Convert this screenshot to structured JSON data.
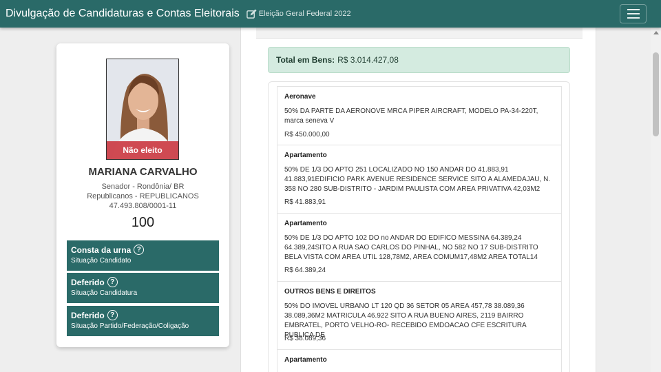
{
  "header": {
    "title": "Divulgação de Candidaturas e Contas Eleitorais",
    "election": "Eleição Geral Federal 2022",
    "icons": [
      "edit-icon",
      "menu-icon"
    ]
  },
  "candidate": {
    "photo_badge": "Não eleito",
    "name": "MARIANA CARVALHO",
    "office": "Senador - Rondônia/ BR",
    "party": "Republicanos - REPUBLICANOS",
    "cnpj": "47.493.808/0001-11",
    "number": "100",
    "statuses": [
      {
        "title": "Consta da urna",
        "subtitle": "Situação Candidato"
      },
      {
        "title": "Deferido",
        "subtitle": "Situação Candidatura"
      },
      {
        "title": "Deferido",
        "subtitle": "Situação Partido/Federação/Coligação"
      }
    ]
  },
  "assets": {
    "total_label": "Total em Bens:",
    "total_value": "R$ 3.014.427,08",
    "items": [
      {
        "type": "Aeronave",
        "description": "50% DA PARTE DA AERONOVE MRCA PIPER AIRCRAFT, MODELO PA-34-220T, marca seneva V",
        "value": "R$ 450.000,00"
      },
      {
        "type": "Apartamento",
        "description": "50% DE 1/3 DO APTO 251 LOCALIZADO NO 150 ANDAR DO 41.883,91 41.883,91EDIFICIO PARK AVENUE RESIDENCE SERVICE SITO A ALAMEDAJAU, N. 358 NO 280 SUB-DISTRITO - JARDIM PAULISTA COM AREA PRIVATIVA 42,03M2",
        "value": "R$ 41.883,91"
      },
      {
        "type": "Apartamento",
        "description": "50% DE 1/3 DO APTO 102 DO no ANDAR DO EDIFICO MESSINA 64.389,24 64.389,24SITO A RUA SAO CARLOS DO PINHAL, NO 582 NO 17 SUB-DISTRITO BELA VISTA COM AREA UTIL 128,78M2, AREA COMUM17,48M2 AREA TOTAL14",
        "value": "R$ 64.389,24"
      },
      {
        "type": "OUTROS BENS E DIREITOS",
        "description": "50% DO IMOVEL URBANO LT 120 QD 36 SETOR 05 AREA 457,78 38.089,36 38.089,36M2 MATRICULA 46.922 SITO A RUA BUENO AIRES, 2119 BAIRRO EMBRATEL, PORTO VELHO-RO- RECEBIDO EMDOACAO CFE ESCRITURA PUBLICA DE",
        "value": "R$ 38.089,36"
      },
      {
        "type": "Apartamento",
        "description": "",
        "value": ""
      }
    ]
  }
}
